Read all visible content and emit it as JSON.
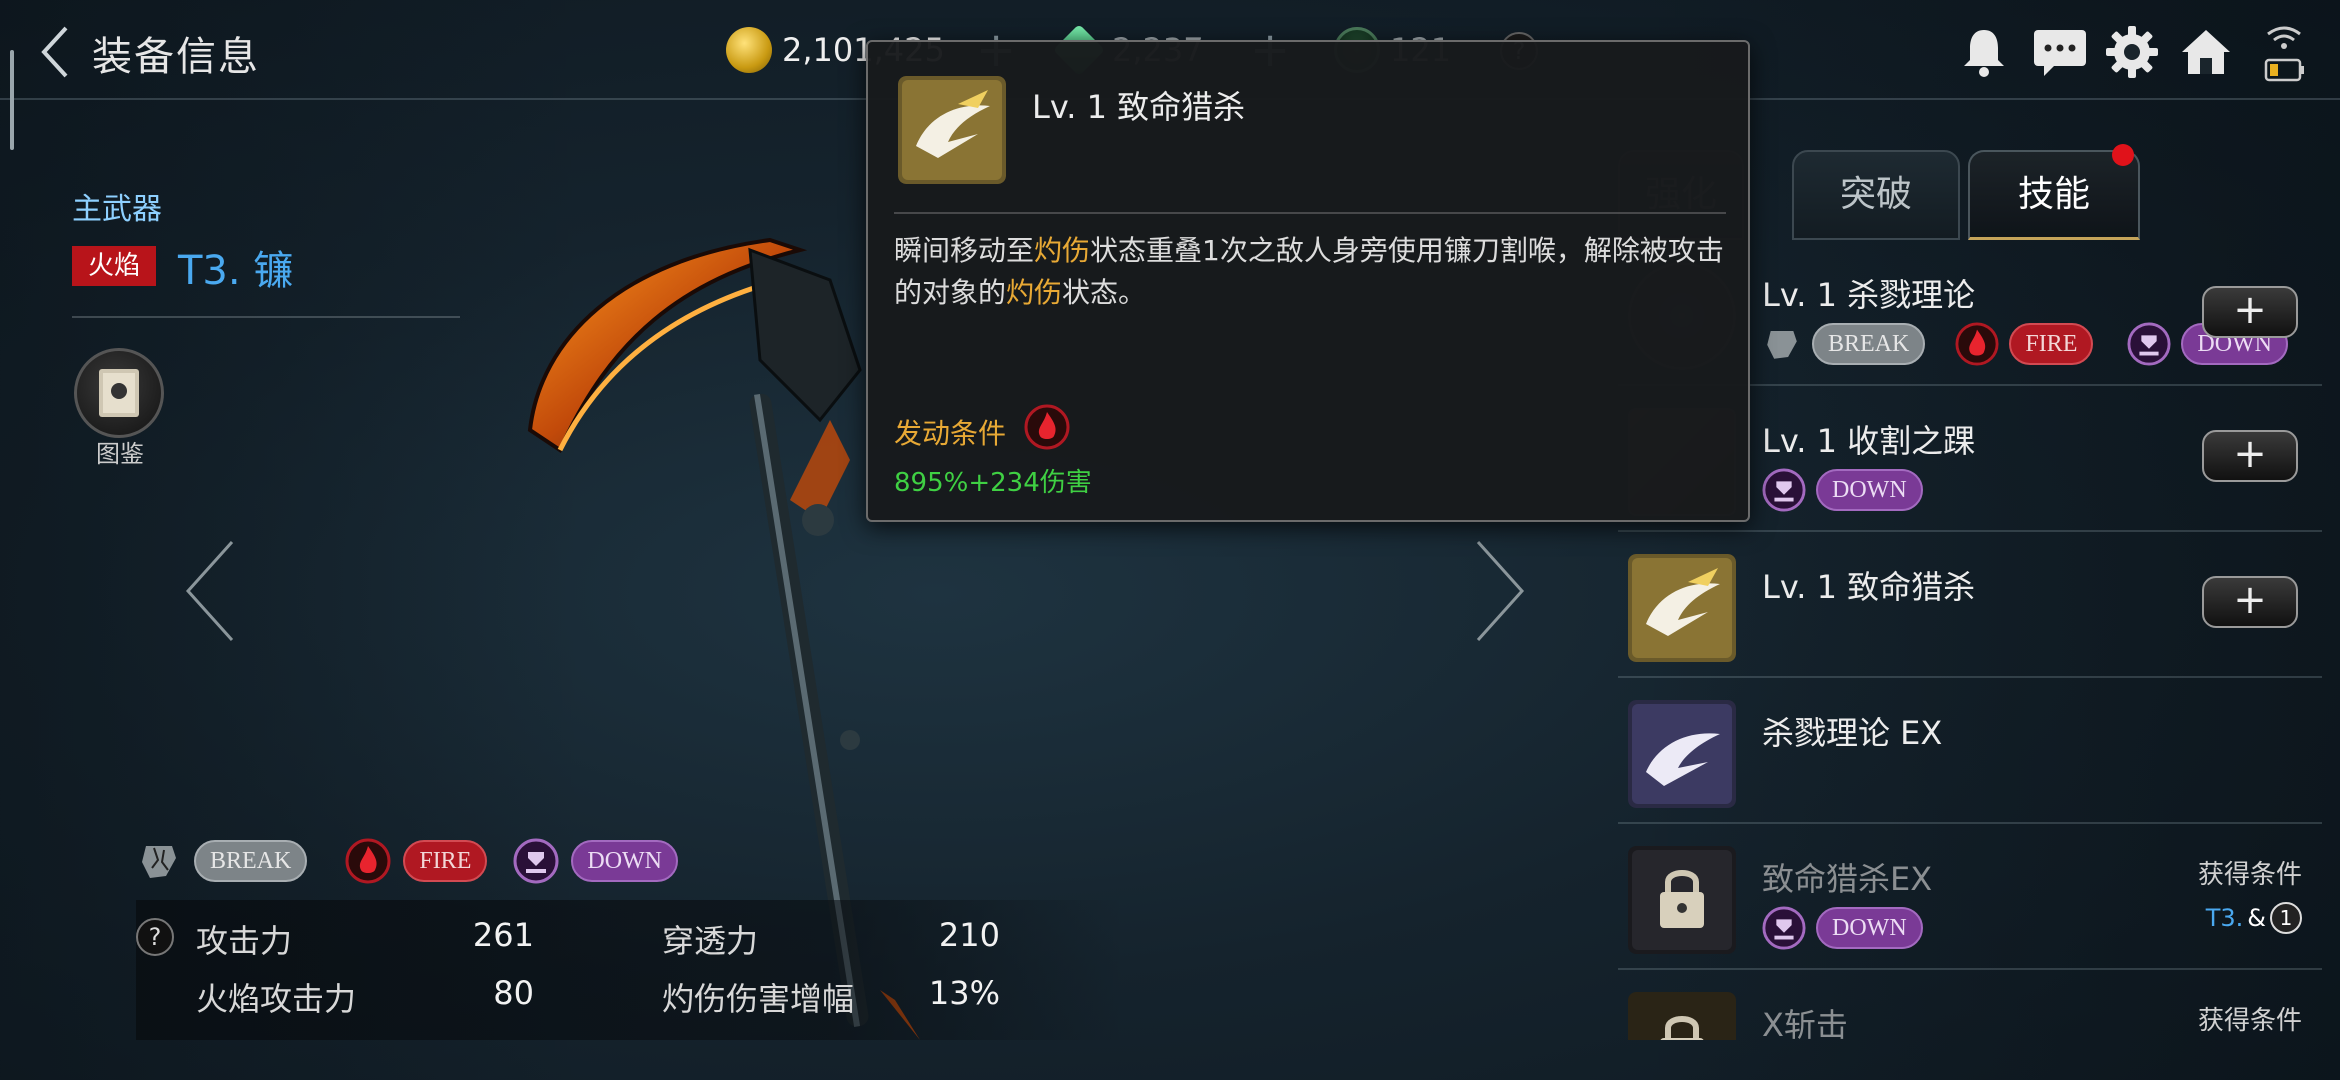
{
  "header": {
    "title": "装备信息",
    "currencies": [
      {
        "name": "gold",
        "value": "2,101,425"
      },
      {
        "name": "green-gem",
        "value": "2,237"
      },
      {
        "name": "emblem",
        "value": "121"
      }
    ],
    "help_mark": "?"
  },
  "weapon": {
    "slot_label": "主武器",
    "element_tag": "火焰",
    "name": "T3. 镰",
    "codex_label": "图鉴",
    "effects": [
      {
        "label": "BREAK",
        "color": "#7d8488"
      },
      {
        "label": "FIRE",
        "color": "#b01822"
      },
      {
        "label": "DOWN",
        "color": "#7a3a96"
      }
    ],
    "stats": [
      {
        "label": "攻击力",
        "value": "261"
      },
      {
        "label": "穿透力",
        "value": "210"
      },
      {
        "label": "火焰攻击力",
        "value": "80"
      },
      {
        "label": "灼伤伤害增幅",
        "value": "13%"
      }
    ]
  },
  "tabs": [
    {
      "label": "强化",
      "active": false
    },
    {
      "label": "突破",
      "active": false
    },
    {
      "label": "技能",
      "active": true
    }
  ],
  "skills": [
    {
      "name": "Lv. 1  杀戮理论",
      "badges": [
        "BREAK",
        "FIRE",
        "DOWN"
      ],
      "plus": "+"
    },
    {
      "name": "Lv. 1  收割之踝",
      "badges": [
        "DOWN"
      ],
      "plus": "+"
    },
    {
      "name": "Lv. 1  致命猎杀",
      "badges": [],
      "plus": "+"
    },
    {
      "name": "杀戮理论  EX",
      "badges": []
    },
    {
      "name": "致命猎杀EX",
      "badges": [
        "DOWN"
      ],
      "condition_label": "获得条件",
      "condition_tier": "T3.",
      "condition_amp": "&",
      "condition_num": "1"
    },
    {
      "name": "X斩击",
      "condition_label": "获得条件"
    }
  ],
  "tooltip": {
    "title": "Lv. 1  致命猎杀",
    "desc_parts": [
      "瞬间移动至",
      "灼伤",
      "状态重叠1次之敌人身旁使用镰刀割喉，解除被攻击的对象的",
      "灼伤",
      "状态。"
    ],
    "condition_label": "发动条件",
    "damage": "895%+234伤害"
  },
  "colors": {
    "accent_blue": "#4aa9f0",
    "highlight_orange": "#e8a935",
    "damage_green": "#3fd043",
    "tab_dot_red": "#e0121a"
  }
}
